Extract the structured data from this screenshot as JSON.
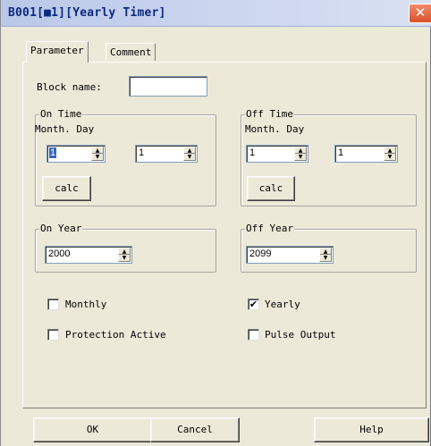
{
  "window": {
    "title": "B001[■1][Yearly Timer]",
    "close_glyph": "✕"
  },
  "tabs": [
    {
      "label": "Parameter",
      "active": true
    },
    {
      "label": "Comment",
      "active": false
    }
  ],
  "block_name": {
    "label": "Block name:",
    "value": ""
  },
  "on_time": {
    "group_label": "On Time",
    "header": "Month. Day",
    "month": "1",
    "day": "1",
    "calc_label": "calc"
  },
  "off_time": {
    "group_label": "Off Time",
    "header": "Month. Day",
    "month": "1",
    "day": "1",
    "calc_label": "calc"
  },
  "on_year": {
    "group_label": "On Year",
    "value": "2000"
  },
  "off_year": {
    "group_label": "Off Year",
    "value": "2099"
  },
  "options": {
    "monthly": {
      "label": "Monthly",
      "checked": false
    },
    "yearly": {
      "label": "Yearly",
      "checked": true
    },
    "protection_active": {
      "label": "Protection Active",
      "checked": false
    },
    "pulse_output": {
      "label": "Pulse Output",
      "checked": false
    }
  },
  "buttons": {
    "ok": "OK",
    "cancel": "Cancel",
    "help": "Help"
  },
  "spin_up_glyph": "▲",
  "spin_down_glyph": "▼",
  "check_glyph": "✔",
  "colors": {
    "title_text": "#0c2a80",
    "close_button": "#d8522c",
    "dialog_face": "#ece9d8",
    "selection": "#316ac5"
  }
}
